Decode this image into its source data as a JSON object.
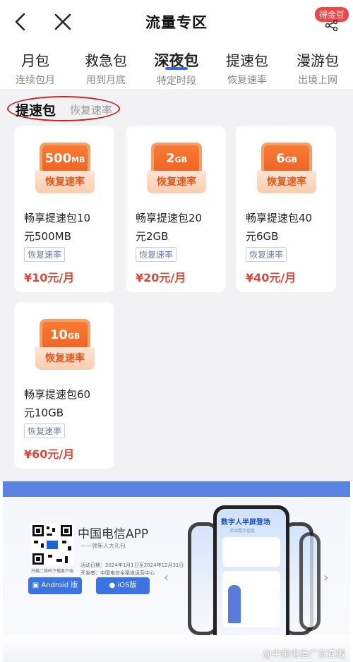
{
  "header": {
    "title": "流量专区",
    "gold_badge": "得金豆"
  },
  "tabs": [
    {
      "name": "月包",
      "sub": "连续包月"
    },
    {
      "name": "救急包",
      "sub": "用到月底"
    },
    {
      "name": "深夜包",
      "sub": "特定时段",
      "active": true
    },
    {
      "name": "提速包",
      "sub": "恢复速率"
    },
    {
      "name": "漫游包",
      "sub": "出境上网"
    }
  ],
  "section": {
    "title": "提速包",
    "subtitle": "恢复速率"
  },
  "cards": [
    {
      "amount": "500",
      "unit": "MB",
      "badge_label": "恢复速率",
      "name_line1": "畅享提速包10",
      "name_line2": "元500MB",
      "tag": "恢复速率",
      "price": "¥10元/月"
    },
    {
      "amount": "2",
      "unit": "GB",
      "badge_label": "恢复速率",
      "name_line1": "畅享提速包20",
      "name_line2": "元2GB",
      "tag": "恢复速率",
      "price": "¥20元/月"
    },
    {
      "amount": "6",
      "unit": "GB",
      "badge_label": "恢复速率",
      "name_line1": "畅享提速包40",
      "name_line2": "元6GB",
      "tag": "恢复速率",
      "price": "¥40元/月"
    },
    {
      "amount": "10",
      "unit": "GB",
      "badge_label": "恢复速率",
      "name_line1": "畅享提速包60",
      "name_line2": "元10GB",
      "tag": "恢复速率",
      "price": "¥60元/月"
    }
  ],
  "banner": {
    "app_name": "中国电信APP",
    "slogan": "——领新人大礼包",
    "qr_caption": "扫描二维码下载客户端",
    "activity_time": "活动日期：2024年1月1日至2024年12月31日",
    "organizer": "开发者：中国电信全渠道运营中心",
    "android_label": "Android 版",
    "ios_label": "iOS版",
    "phone_header": "数字人半屏登场",
    "phone_sub": "活动提示信息"
  },
  "watermark": "@中国电信广东客服",
  "colors": {
    "accent": "#3a6ee8",
    "price": "#d64a3c",
    "badge_orange": "#f97b33",
    "banner_blue": "#5b83e0",
    "annotation_red": "#c9231f"
  }
}
